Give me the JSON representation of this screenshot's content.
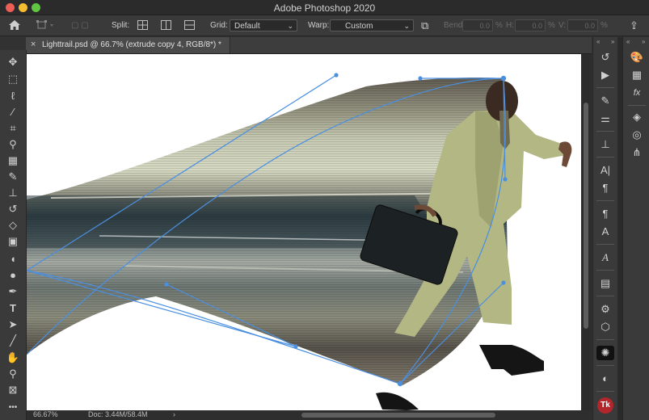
{
  "window": {
    "title": "Adobe Photoshop 2020"
  },
  "options_bar": {
    "split_label": "Split:",
    "grid_label": "Grid:",
    "grid_value": "Default",
    "warp_label": "Warp:",
    "warp_value": "Custom",
    "bend_label": "Bend:",
    "bend_value": "0.0",
    "h_label": "H:",
    "h_value": "0.0",
    "v_label": "V:",
    "v_value": "0.0",
    "percent": "%"
  },
  "document": {
    "tab_close": "×",
    "tab_label": "Lighttrail.psd @ 66.7% (extrude copy 4, RGB/8*) *"
  },
  "status": {
    "zoom": "66.67%",
    "doc": "Doc: 3.44M/58.4M",
    "arrow": "›"
  },
  "toolbar": {
    "tools": [
      "move-icon",
      "marquee-icon",
      "lasso-icon",
      "magic-wand-icon",
      "crop-icon",
      "eyedropper-icon",
      "healing-icon",
      "brush-icon",
      "stamp-icon",
      "history-brush-icon",
      "eraser-icon",
      "gradient-icon",
      "blur-icon",
      "dodge-icon",
      "pen-icon",
      "type-icon",
      "path-select-icon",
      "line-icon",
      "hand-icon",
      "zoom-icon",
      "frame-icon",
      "more-icon"
    ],
    "more_label": "•••"
  },
  "panels": {
    "collapse": "«",
    "expand": "»"
  },
  "icons": {
    "home": "home-icon",
    "transform": "transform-icon",
    "warp_reset": "warp-reset-icon"
  },
  "colors": {
    "accent": "#4a8fe0",
    "bg": "#323232"
  }
}
